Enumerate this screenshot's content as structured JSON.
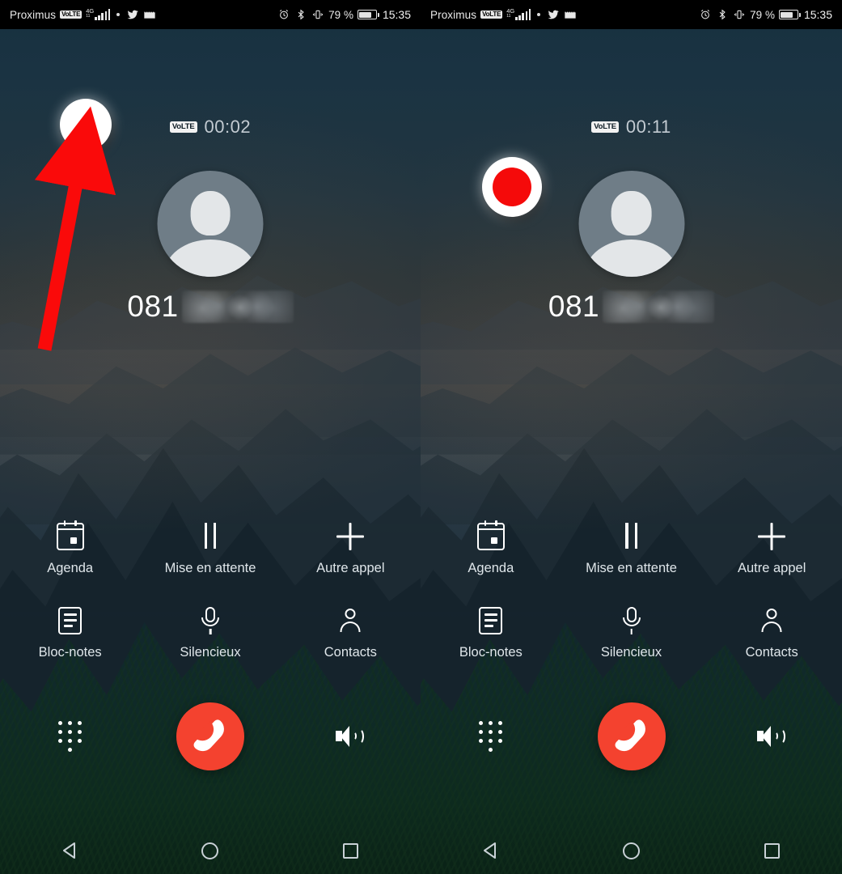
{
  "meta": {
    "app": "Huawei EMUI Phone — appel en cours",
    "language": "fr"
  },
  "status_bar": {
    "carrier": "Proximus",
    "volte_label": "VoLTE",
    "network": "4G",
    "network_sub": "LTE",
    "icons_left": [
      "volte-badge-icon",
      "signal-bars-icon",
      "dot-icon",
      "twitter-icon",
      "film-icon"
    ],
    "icons_right": [
      "alarm-icon",
      "bluetooth-icon",
      "vibrate-icon",
      "battery-icon"
    ],
    "battery_percent": "79 %",
    "clock": "15:35"
  },
  "panels": [
    {
      "id": "before",
      "record_button": {
        "name": "call-record-button",
        "state": "idle",
        "accent": "#ef1010"
      },
      "call": {
        "volte_label": "VoLTE",
        "timer": "00:02",
        "number": "081",
        "number_redacted": true
      },
      "annotation": {
        "type": "arrow",
        "color": "#fa0a0a",
        "points_to": "call-record-button"
      }
    },
    {
      "id": "after",
      "record_button": {
        "name": "call-record-button",
        "state": "recording",
        "accent": "#f50a0a"
      },
      "call": {
        "volte_label": "VoLTE",
        "timer": "00:11",
        "number": "081",
        "number_redacted": true
      },
      "annotation": null
    }
  ],
  "actions": [
    {
      "icon": "calendar-icon",
      "label": "Agenda"
    },
    {
      "icon": "pause-icon",
      "label": "Mise en attente"
    },
    {
      "icon": "plus-icon",
      "label": "Autre appel"
    },
    {
      "icon": "notes-icon",
      "label": "Bloc-notes"
    },
    {
      "icon": "microphone-icon",
      "label": "Silencieux"
    },
    {
      "icon": "person-icon",
      "label": "Contacts"
    }
  ],
  "bottom_controls": [
    {
      "icon": "keypad-icon",
      "name": "keypad-button"
    },
    {
      "icon": "hangup-icon",
      "name": "end-call-button",
      "color": "#f4422f"
    },
    {
      "icon": "speaker-icon",
      "name": "speaker-button"
    }
  ],
  "nav_bar": [
    {
      "icon": "back-triangle-icon",
      "name": "nav-back-button"
    },
    {
      "icon": "home-circle-icon",
      "name": "nav-home-button"
    },
    {
      "icon": "recents-square-icon",
      "name": "nav-recents-button"
    }
  ],
  "colors": {
    "record_red": "#f50a0a",
    "end_call_red": "#f4422f",
    "arrow_red": "#fa0a0a",
    "text_primary": "#ffffff",
    "text_secondary": "#dfe6ea",
    "wallpaper_top": "#17303f",
    "wallpaper_bottom": "#091520"
  }
}
